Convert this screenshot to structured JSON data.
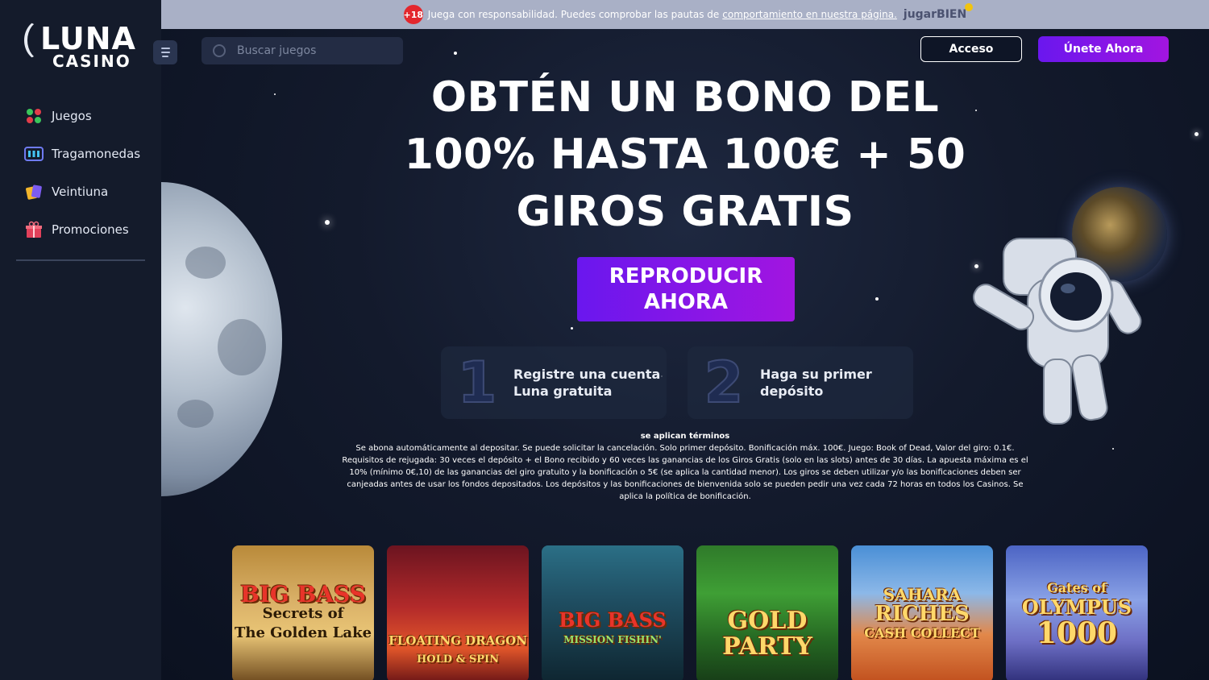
{
  "brand": {
    "name": "LUNA",
    "sub": "CASINO"
  },
  "sidebar": {
    "items": [
      {
        "label": "Juegos",
        "icon": "games-icon"
      },
      {
        "label": "Tragamonedas",
        "icon": "slots-icon"
      },
      {
        "label": "Veintiuna",
        "icon": "cards-icon"
      },
      {
        "label": "Promociones",
        "icon": "gift-icon"
      }
    ]
  },
  "topbar": {
    "age_badge": "+18",
    "message": "Juega con responsabilidad. Puedes comprobar las pautas de",
    "link": "comportamiento en nuestra página.",
    "partner": "jugarBIEN"
  },
  "header": {
    "search_placeholder": "Buscar juegos",
    "login_label": "Acceso",
    "join_label": "Únete Ahora"
  },
  "hero": {
    "headline_line1": "OBTÉN UN BONO DEL",
    "headline_line2": "100% HASTA 100€ + 50",
    "headline_line3": "GIROS GRATIS",
    "cta_line1": "REPRODUCIR",
    "cta_line2": "AHORA",
    "steps": [
      {
        "num": "1",
        "line1": "Registre una cuenta",
        "line2": "Luna gratuita"
      },
      {
        "num": "2",
        "line1": "Haga su primer",
        "line2": "depósito"
      }
    ]
  },
  "terms": {
    "title": "se aplican términos",
    "line1": "Se abona automáticamente al depositar. Se puede solicitar la cancelación. Solo primer depósito. Bonificación máx. 100€. Juego: Book of Dead, Valor del giro: 0.1€.",
    "line2": "Requisitos de rejugada: 30 veces el depósito + el Bono recibido y 60 veces las ganancias de los Giros Gratis (solo en las slots) antes de 30 días. La apuesta máxima es el",
    "line3": "10% (mínimo 0€,10) de las ganancias del giro gratuito y la bonificación o 5€ (se aplica la cantidad menor). Los giros se deben utilizar y/o las bonificaciones deben ser",
    "line4": "canjeadas antes de usar los fondos depositados. Los depósitos y las bonificaciones de bienvenida solo se pueden pedir una vez cada 72 horas en todos los Casinos. Se",
    "line5": "aplica la política de bonificación."
  },
  "games": [
    {
      "line1": "BIG BASS",
      "line2": "Secrets of",
      "line3": "The Golden Lake"
    },
    {
      "line1": "FLOATING DRAGON",
      "line2": "HOLD & SPIN",
      "line3": ""
    },
    {
      "line1": "BIG BASS",
      "line2": "MISSION FISHIN'",
      "line3": ""
    },
    {
      "line1": "GOLD",
      "line2": "PARTY",
      "line3": ""
    },
    {
      "line1": "SAHARA",
      "line2": "RICHES",
      "line3": "CASH COLLECT"
    },
    {
      "line1": "Gates of",
      "line2": "OLYMPUS",
      "line3": "1000"
    }
  ],
  "colors": {
    "accent": "#7a16ea",
    "bg": "#0d1322",
    "sidebar": "#141b2b"
  }
}
